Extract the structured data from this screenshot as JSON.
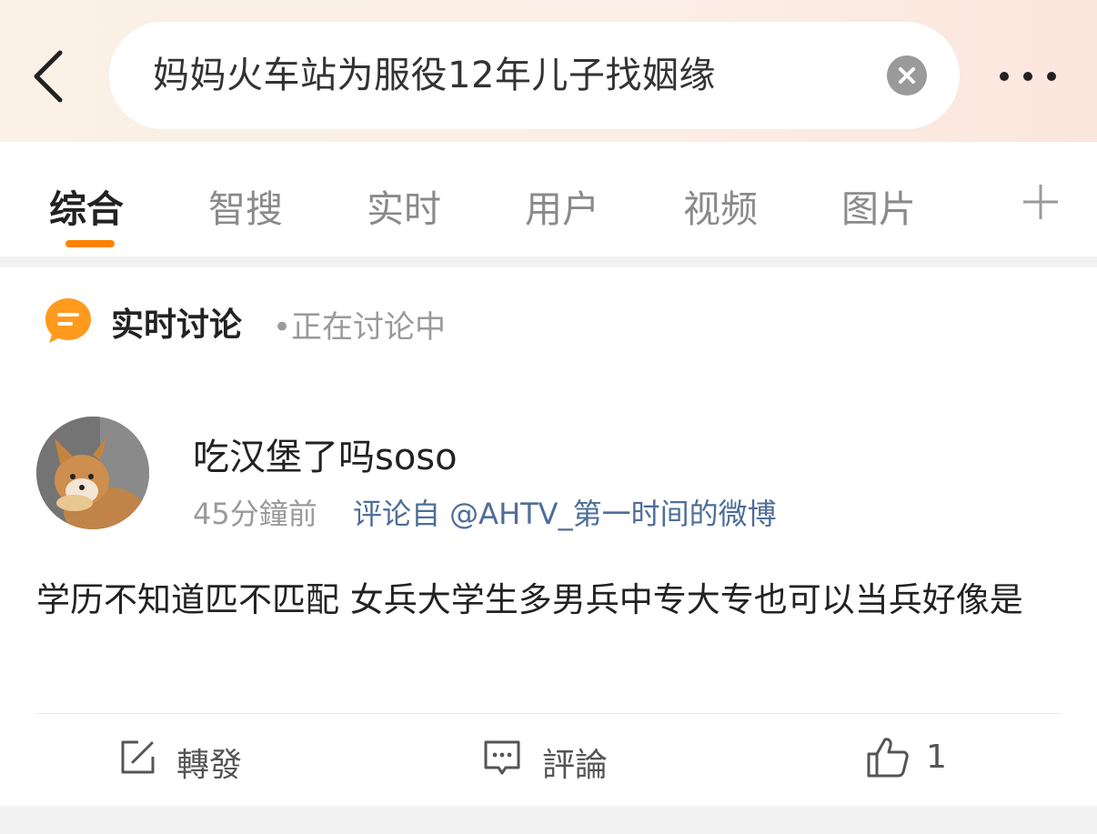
{
  "search": {
    "query": "妈妈火车站为服役12年儿子找姻缘"
  },
  "tabs": [
    {
      "label": "综合",
      "active": true
    },
    {
      "label": "智搜"
    },
    {
      "label": "实时"
    },
    {
      "label": "用户"
    },
    {
      "label": "视频"
    },
    {
      "label": "图片"
    }
  ],
  "section": {
    "title": "实时讨论",
    "status": "•正在讨论中"
  },
  "post": {
    "username": "吃汉堡了吗soso",
    "time": "45分鐘前",
    "source": "评论自 @AHTV_第一时间的微博",
    "text": "学历不知道匹不匹配 女兵大学生多男兵中专大专也可以当兵好像是"
  },
  "actions": {
    "repost_label": "轉發",
    "comment_label": "評論",
    "like_count": "1"
  },
  "colors": {
    "accent": "#ff8200",
    "link": "#4e6e98",
    "section_icon": "#ff9a1e"
  },
  "icons": [
    "back-chevron-icon",
    "clear-icon",
    "more-dots-icon",
    "plus-icon",
    "chat-bubble-icon",
    "edit-icon",
    "comment-icon",
    "thumb-up-icon"
  ]
}
